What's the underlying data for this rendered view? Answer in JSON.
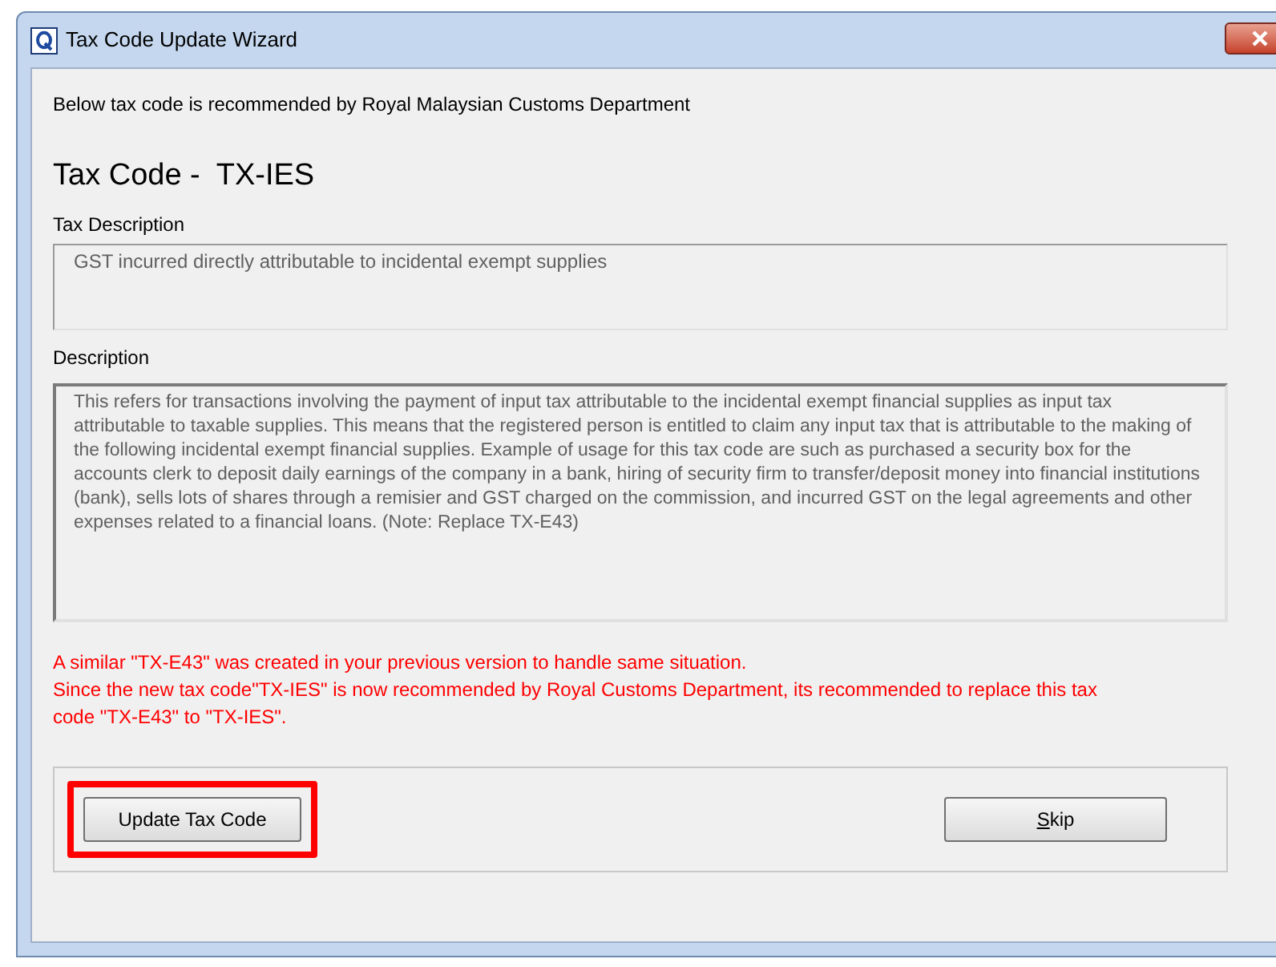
{
  "window": {
    "title": "Tax Code Update Wizard"
  },
  "intro": "Below tax code is recommended by Royal Malaysian Customs Department",
  "heading": {
    "label": "Tax Code -",
    "code": "TX-IES"
  },
  "tax_description": {
    "label": "Tax Description",
    "value": "GST incurred directly attributable to incidental exempt supplies"
  },
  "description": {
    "label": "Description",
    "value": "This refers for transactions involving the payment of input tax attributable to the incidental exempt financial supplies as input tax attributable to taxable supplies. This means that the registered person is entitled to claim any input tax that is attributable to the making of the following incidental exempt financial supplies. Example of usage for this tax code are such as purchased a security box for the accounts clerk to deposit daily earnings of the company in a bank, hiring of security firm to transfer/deposit money into financial institutions (bank), sells lots of shares through a remisier and GST charged on the commission, and incurred GST on the legal agreements and other expenses related to a financial loans. (Note: Replace TX-E43)"
  },
  "warning": [
    "A similar \"TX-E43\" was created in your previous version to handle same situation.",
    "Since the new tax code\"TX-IES\" is now recommended by Royal Customs Department, its recommended to replace this tax code \"TX-E43\" to \"TX-IES\"."
  ],
  "buttons": [
    {
      "label": "Update Tax Code",
      "highlighted": true
    },
    {
      "label": "Skip",
      "highlighted": false,
      "first_letter_underlined": true
    }
  ]
}
